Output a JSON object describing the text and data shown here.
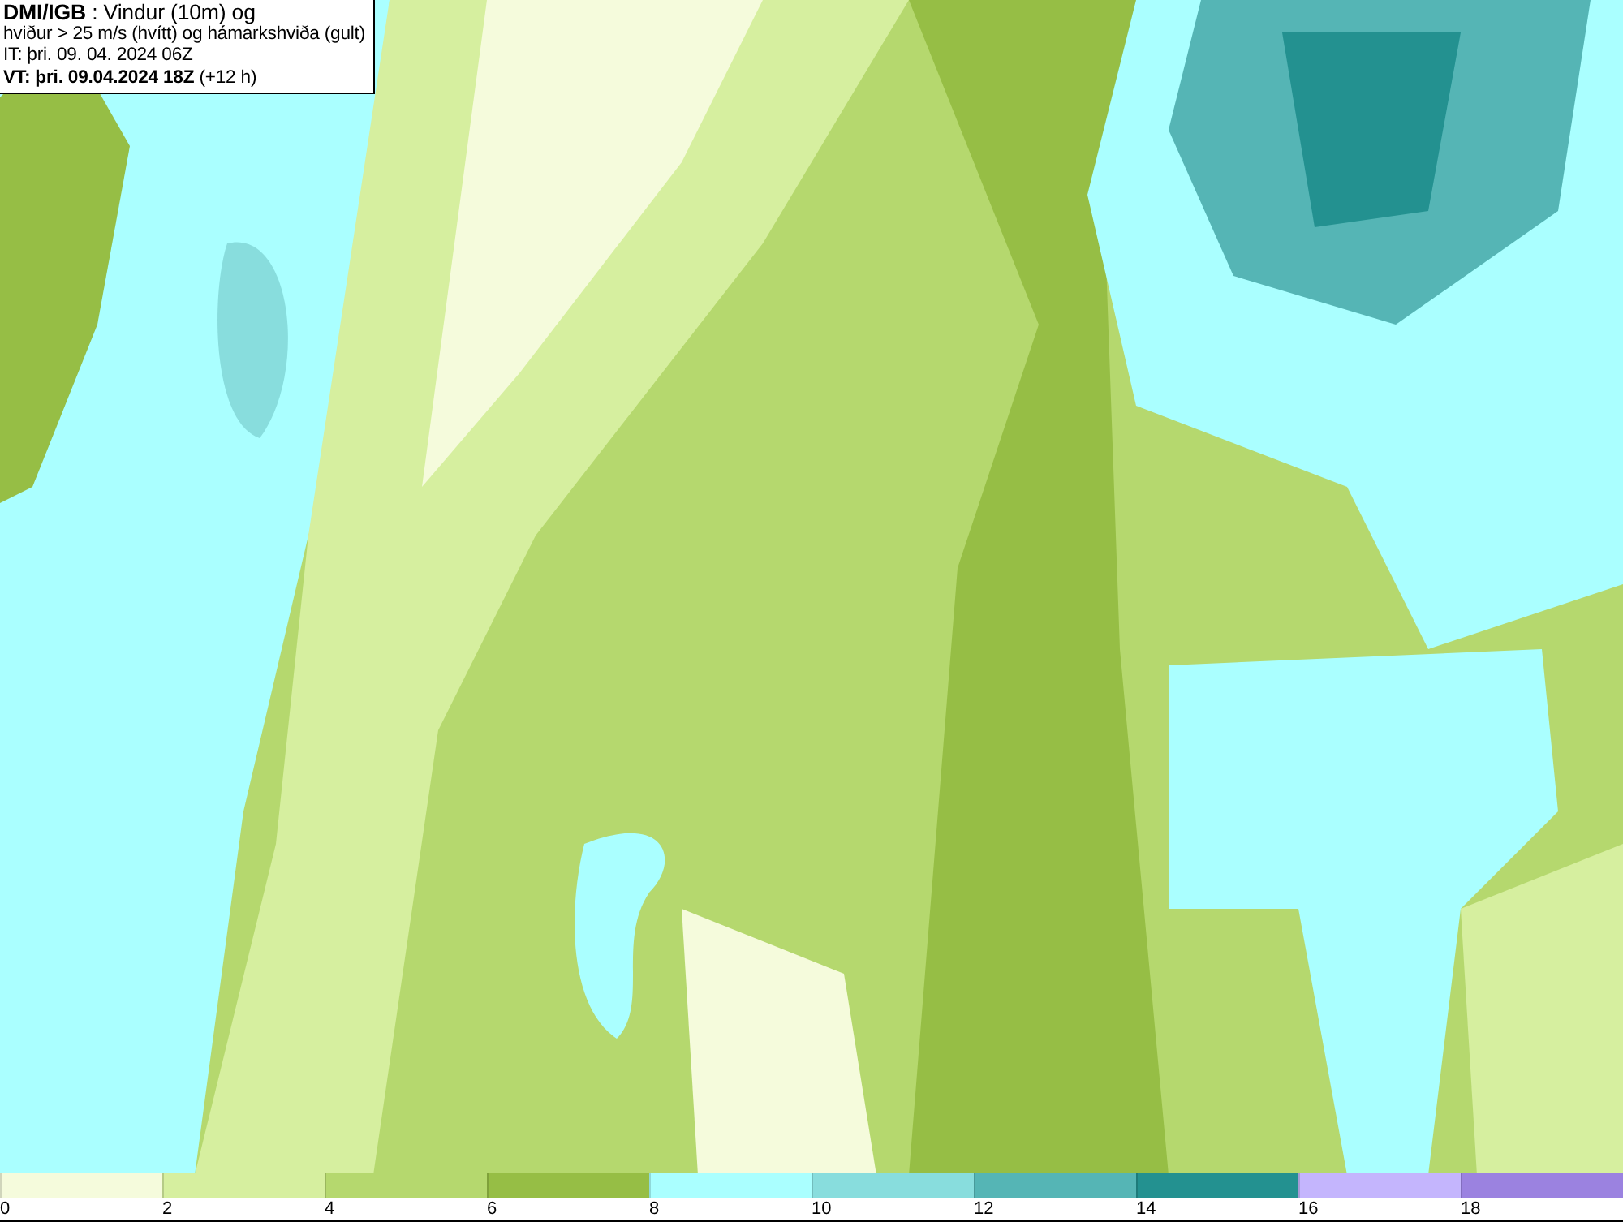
{
  "title_box": {
    "lines": [
      "**DMI/IGB** : Vindur (10m) og",
      "hviður > 25 m/s (hvítt) og hámarkshviða (gult)",
      "IT: þri. 09. 04. 2024 06Z",
      "**VT: þri. 09.04.2024 18Z** (+12 h)"
    ]
  },
  "legend": [
    {
      "label": "0",
      "color": "#f5fbdc"
    },
    {
      "label": "2",
      "color": "#d6ef9f"
    },
    {
      "label": "4",
      "color": "#b5d86e"
    },
    {
      "label": "6",
      "color": "#96be45"
    },
    {
      "label": "8",
      "color": "#aaffff"
    },
    {
      "label": "10",
      "color": "#88dddd"
    },
    {
      "label": "12",
      "color": "#55b5b5"
    },
    {
      "label": "14",
      "color": "#239190"
    },
    {
      "label": "16",
      "color": "#c4b5fd"
    },
    {
      "label": "18",
      "color": "#9b82e0"
    }
  ]
}
